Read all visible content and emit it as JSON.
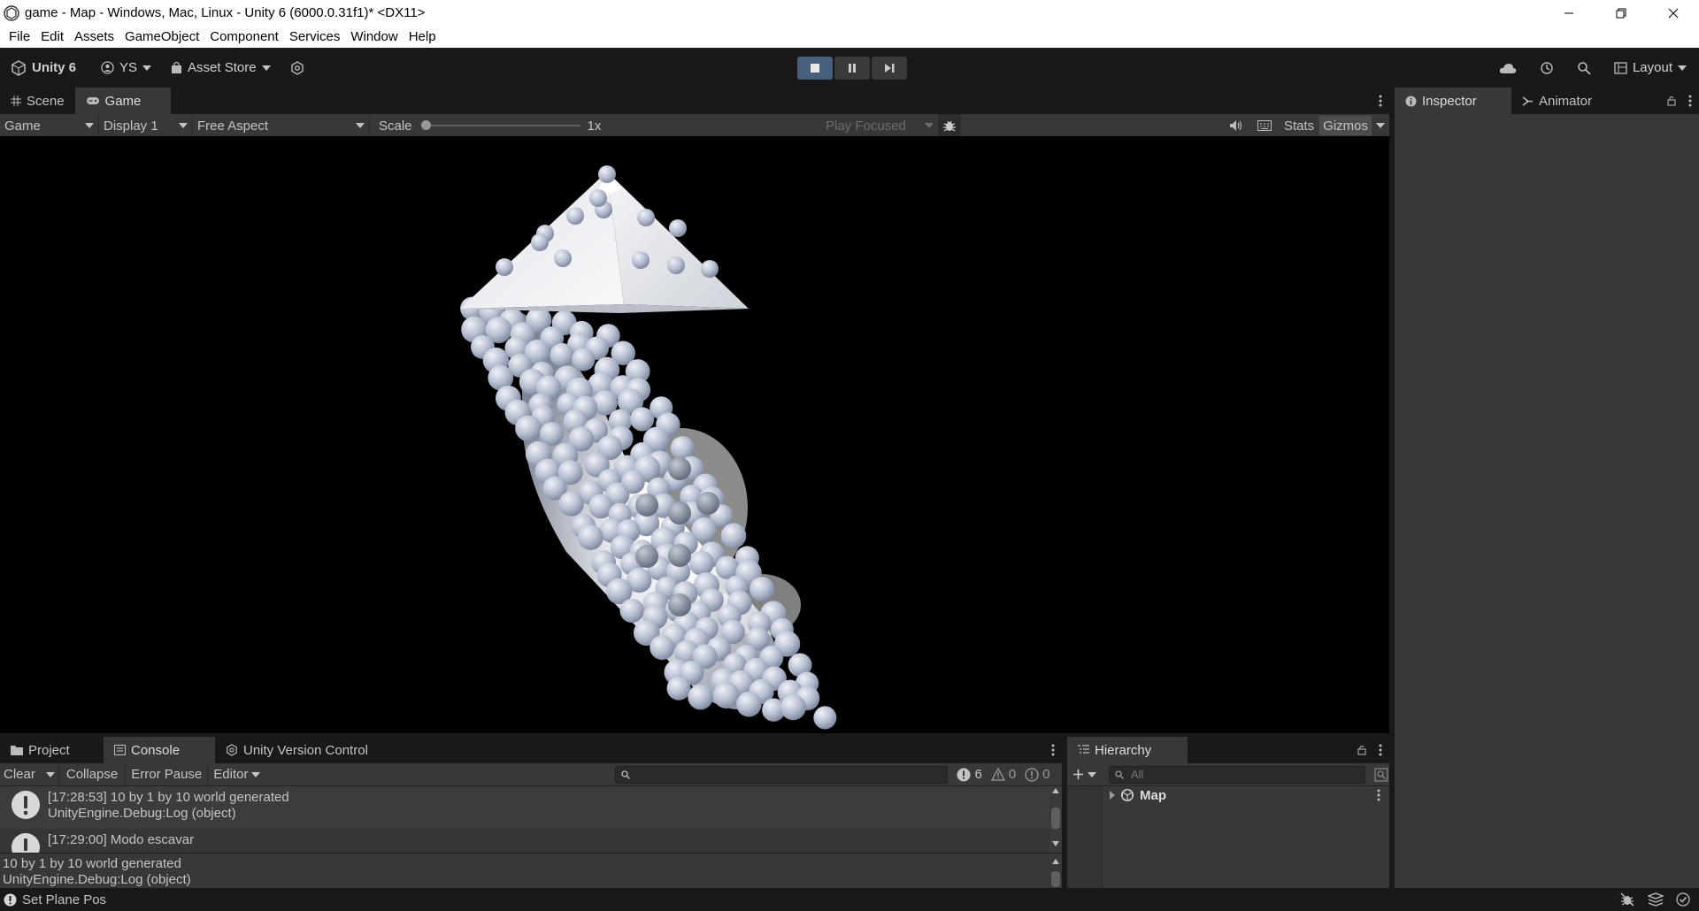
{
  "window": {
    "title": "game - Map - Windows, Mac, Linux - Unity 6 (6000.0.31f1)* <DX11>"
  },
  "menu": [
    "File",
    "Edit",
    "Assets",
    "GameObject",
    "Component",
    "Services",
    "Window",
    "Help"
  ],
  "toolbar": {
    "unity_label": "Unity 6",
    "account": "YS",
    "asset_store": "Asset Store",
    "layout": "Layout"
  },
  "tabs": {
    "scene": "Scene",
    "game": "Game",
    "inspector": "Inspector",
    "animator": "Animator"
  },
  "game_toolbar": {
    "view": "Game",
    "display": "Display 1",
    "aspect": "Free Aspect",
    "scale_label": "Scale",
    "scale_value": "1x",
    "play_focused": "Play Focused",
    "stats": "Stats",
    "gizmos": "Gizmos"
  },
  "bottom_tabs": {
    "project": "Project",
    "console": "Console",
    "uvc": "Unity Version Control",
    "hierarchy": "Hierarchy"
  },
  "console_toolbar": {
    "clear": "Clear",
    "collapse": "Collapse",
    "error_pause": "Error Pause",
    "editor": "Editor",
    "log_count": "6",
    "warn_count": "0",
    "error_count": "0"
  },
  "console": {
    "entries": [
      {
        "line1": "[17:28:53] 10 by 1 by 10 world generated",
        "line2": "UnityEngine.Debug:Log (object)"
      },
      {
        "line1": "[17:29:00] Modo escavar",
        "line2": ""
      }
    ],
    "detail_line1": "10 by 1 by 10 world generated",
    "detail_line2": "UnityEngine.Debug:Log (object)"
  },
  "hierarchy": {
    "search_placeholder": "All",
    "root": "Map"
  },
  "status": {
    "text": "Set Plane Pos"
  },
  "colors": {
    "play_active": "#46607c",
    "panel": "#383838",
    "dark": "#191919"
  }
}
